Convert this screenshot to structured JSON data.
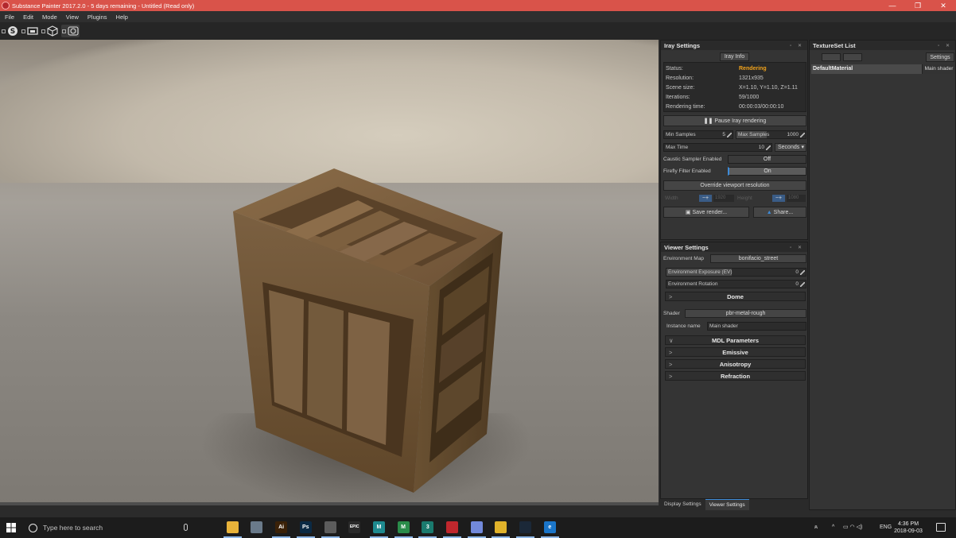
{
  "window": {
    "title": "Substance Painter 2017.2.0 - 5 days remaining - Untitled (Read only)",
    "controls": [
      "—",
      "❐",
      "✕"
    ]
  },
  "menu": [
    "File",
    "Edit",
    "Mode",
    "View",
    "Plugins",
    "Help"
  ],
  "toolbar": {
    "icons": [
      "substance-logo-icon",
      "2d-view-icon",
      "3d-cube-icon",
      "iray-render-icon"
    ]
  },
  "iray": {
    "title": "Iray Settings",
    "info_button": "Iray Info",
    "status_label": "Status:",
    "status_value": "Rendering",
    "resolution_label": "Resolution:",
    "resolution_value": "1321x935",
    "scene_size_label": "Scene size:",
    "scene_size_value": "X=1.10, Y=1.10, Z=1.11",
    "iterations_label": "Iterations:",
    "iterations_value": "59/1000",
    "rendering_time_label": "Rendering time:",
    "rendering_time_value": "00:00:03/00:00:10",
    "pause_button": "Pause Iray rendering",
    "min_samples_label": "Min Samples",
    "min_samples_value": "5",
    "max_samples_label": "Max Samples",
    "max_samples_value": "1000",
    "max_time_label": "Max Time",
    "max_time_value": "10",
    "time_unit": "Seconds",
    "caustic_label": "Caustic Sampler Enabled",
    "caustic_value": "Off",
    "firefly_label": "Firefly Filter Enabled",
    "firefly_value": "On",
    "override_button": "Override viewport resolution",
    "width_label": "Width",
    "width_value": "1920",
    "height_label": "Height",
    "height_value": "1080",
    "save_button": "Save render...",
    "share_button": "Share..."
  },
  "viewer": {
    "title": "Viewer Settings",
    "env_map_label": "Environment Map",
    "env_map_value": "bonifacio_street",
    "env_exposure_label": "Environment Exposure (EV)",
    "env_exposure_value": "0",
    "env_rotation_label": "Environment Rotation",
    "env_rotation_value": "0",
    "dome_section": "Dome",
    "shader_label": "Shader",
    "shader_value": "pbr-metal-rough",
    "instance_label": "Instance name",
    "instance_value": "Main shader",
    "mdl_section": "MDL Parameters",
    "emissive_section": "Emissive",
    "anisotropy_section": "Anisotropy",
    "refraction_section": "Refraction"
  },
  "bottom_tabs": [
    "Display Settings",
    "Viewer Settings"
  ],
  "texset": {
    "title": "TextureSet List",
    "settings_button": "Settings",
    "material_name": "DefaultMaterial",
    "material_shader": "Main shader"
  },
  "taskbar": {
    "search_placeholder": "Type here to search",
    "apps": [
      {
        "name": "task-view-icon",
        "label": "",
        "color": "#1c1c1c"
      },
      {
        "name": "file-explorer-icon",
        "label": "",
        "color": "#e8b33a"
      },
      {
        "name": "pictures-icon",
        "label": "",
        "color": "#6a7a8a"
      },
      {
        "name": "illustrator-icon",
        "label": "Ai",
        "color": "#3a2108"
      },
      {
        "name": "photoshop-icon",
        "label": "Ps",
        "color": "#0b2a44"
      },
      {
        "name": "photo-icon",
        "label": "",
        "color": "#5c5c5c"
      },
      {
        "name": "epic-games-icon",
        "label": "EPIC",
        "color": "#2a2a2a"
      },
      {
        "name": "maya-icon",
        "label": "M",
        "color": "#1e8a8f"
      },
      {
        "name": "mudbox-icon",
        "label": "M",
        "color": "#2a8c4a"
      },
      {
        "name": "3dsmax-icon",
        "label": "3",
        "color": "#1a7a6e"
      },
      {
        "name": "substance-painter-icon",
        "label": "",
        "color": "#c0272d"
      },
      {
        "name": "discord-icon",
        "label": "",
        "color": "#7289da"
      },
      {
        "name": "chrome-icon",
        "label": "",
        "color": "#e0b22a"
      },
      {
        "name": "steam-icon",
        "label": "",
        "color": "#1b2838"
      },
      {
        "name": "edge-icon",
        "label": "e",
        "color": "#1a75c9"
      }
    ],
    "language": "ENG",
    "time": "4:36 PM",
    "date": "2018-09-03"
  }
}
